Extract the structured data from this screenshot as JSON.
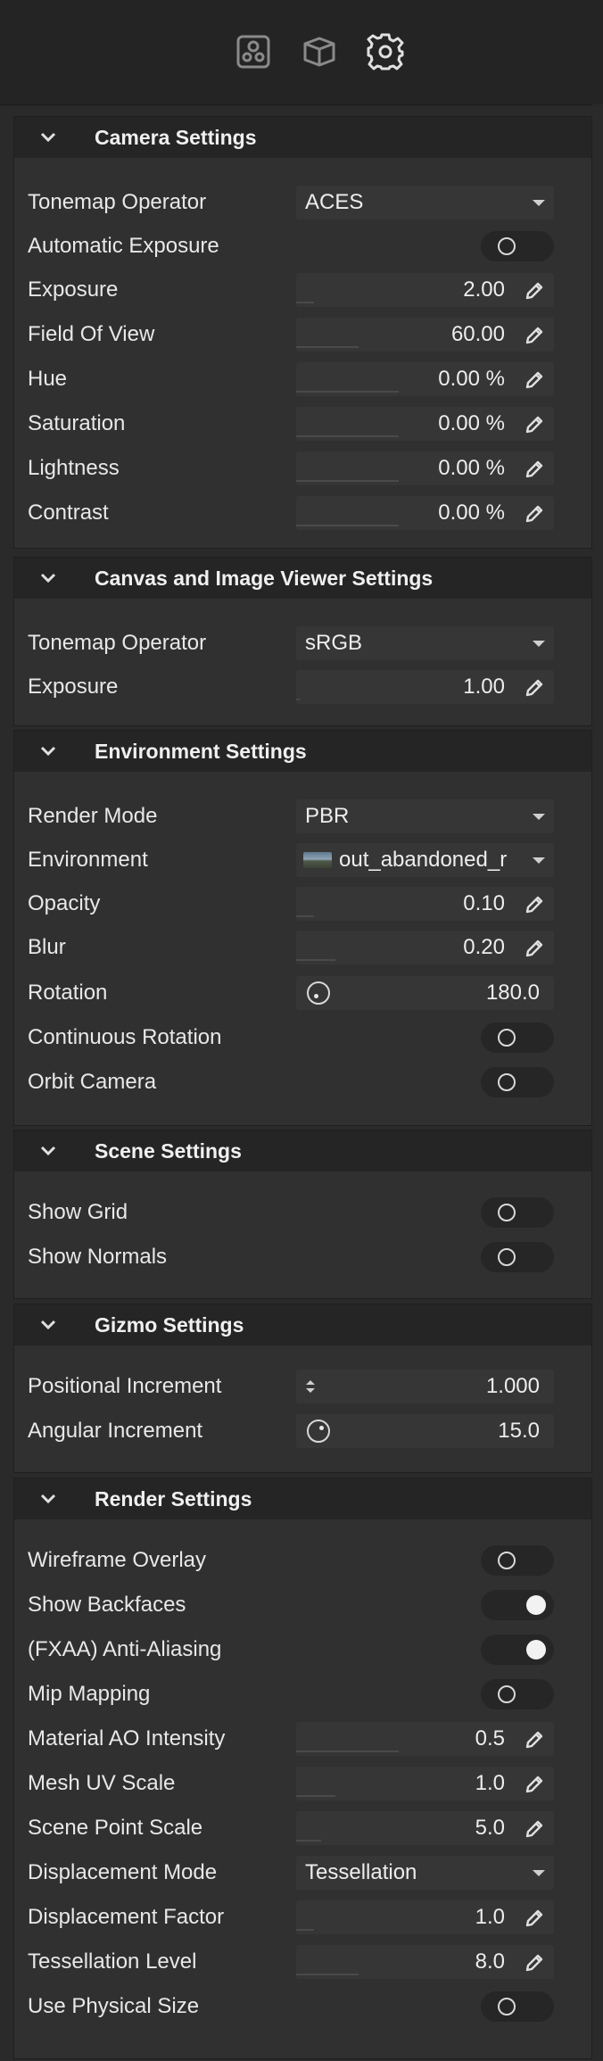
{
  "tabs": [
    {
      "name": "scene-hierarchy-tab"
    },
    {
      "name": "assets-tab"
    },
    {
      "name": "settings-tab",
      "active": true
    }
  ],
  "panels": {
    "camera": {
      "title": "Camera Settings",
      "tonemap_label": "Tonemap Operator",
      "tonemap_value": "ACES",
      "auto_exposure_label": "Automatic Exposure",
      "auto_exposure_on": false,
      "exposure_label": "Exposure",
      "exposure_value": "2.00",
      "fov_label": "Field Of View",
      "fov_value": "60.00",
      "hue_label": "Hue",
      "hue_value": "0.00 %",
      "saturation_label": "Saturation",
      "saturation_value": "0.00 %",
      "lightness_label": "Lightness",
      "lightness_value": "0.00 %",
      "contrast_label": "Contrast",
      "contrast_value": "0.00 %"
    },
    "canvas": {
      "title": "Canvas and Image Viewer Settings",
      "tonemap_label": "Tonemap Operator",
      "tonemap_value": "sRGB",
      "exposure_label": "Exposure",
      "exposure_value": "1.00"
    },
    "environment": {
      "title": "Environment Settings",
      "render_mode_label": "Render Mode",
      "render_mode_value": "PBR",
      "environment_label": "Environment",
      "environment_value": "out_abandoned_r",
      "opacity_label": "Opacity",
      "opacity_value": "0.10",
      "blur_label": "Blur",
      "blur_value": "0.20",
      "rotation_label": "Rotation",
      "rotation_value": "180.0",
      "continuous_rotation_label": "Continuous Rotation",
      "continuous_rotation_on": false,
      "orbit_camera_label": "Orbit Camera",
      "orbit_camera_on": false
    },
    "scene": {
      "title": "Scene Settings",
      "show_grid_label": "Show Grid",
      "show_grid_on": false,
      "show_normals_label": "Show Normals",
      "show_normals_on": false
    },
    "gizmo": {
      "title": "Gizmo Settings",
      "positional_label": "Positional Increment",
      "positional_value": "1.000",
      "angular_label": "Angular Increment",
      "angular_value": "15.0"
    },
    "render": {
      "title": "Render Settings",
      "wireframe_label": "Wireframe Overlay",
      "wireframe_on": false,
      "backfaces_label": "Show Backfaces",
      "backfaces_on": true,
      "fxaa_label": "(FXAA) Anti-Aliasing",
      "fxaa_on": true,
      "mip_label": "Mip Mapping",
      "mip_on": false,
      "ao_label": "Material AO Intensity",
      "ao_value": "0.5",
      "uv_label": "Mesh UV Scale",
      "uv_value": "1.0",
      "point_label": "Scene Point Scale",
      "point_value": "5.0",
      "disp_mode_label": "Displacement Mode",
      "disp_mode_value": "Tessellation",
      "disp_factor_label": "Displacement Factor",
      "disp_factor_value": "1.0",
      "tess_label": "Tessellation Level",
      "tess_value": "8.0",
      "physical_label": "Use Physical Size",
      "physical_on": false
    }
  },
  "colors": {
    "background": "#2a2a2a",
    "panel": "#303030",
    "header": "#252525",
    "field": "#363636",
    "text": "#e6e6e6"
  }
}
